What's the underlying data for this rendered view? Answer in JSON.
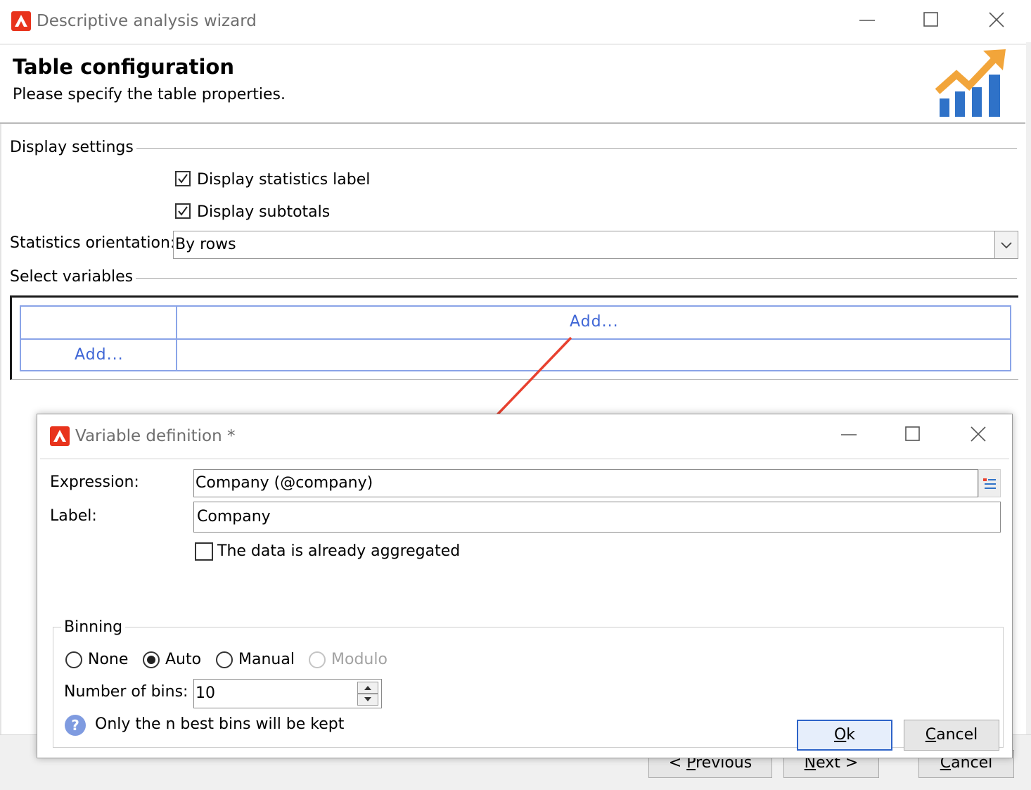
{
  "window": {
    "title": "Descriptive analysis wizard",
    "header_title": "Table configuration",
    "header_subtitle": "Please specify the table properties."
  },
  "display_settings": {
    "group_label": "Display settings",
    "statistics_label": {
      "label": "Display statistics label",
      "checked": true
    },
    "subtotals": {
      "label": "Display subtotals",
      "checked": true
    },
    "orientation_label": "Statistics orientation:",
    "orientation_value": "By rows"
  },
  "select_variables": {
    "group_label": "Select variables",
    "add_column": "Add...",
    "add_row": "Add..."
  },
  "footer": {
    "previous": {
      "pre": "< ",
      "key": "P",
      "rest": "revious"
    },
    "next": {
      "key": "N",
      "rest": "ext >"
    },
    "cancel": {
      "key": "C",
      "rest": "ancel"
    }
  },
  "dialog": {
    "title": "Variable definition *",
    "expression_label": "Expression:",
    "expression_value": "Company (@company)",
    "label_label": "Label:",
    "label_value": "Company",
    "aggregated": {
      "label": "The data is already aggregated",
      "checked": false
    },
    "binning": {
      "group_label": "Binning",
      "options": [
        "None",
        "Auto",
        "Manual",
        "Modulo"
      ],
      "selected": "Auto",
      "disabled": [
        "Modulo"
      ],
      "bins_label": "Number of bins:",
      "bins_value": "10",
      "hint": "Only the n best bins will be kept"
    },
    "ok": {
      "key": "O",
      "rest": "k"
    },
    "cancel": {
      "key": "C",
      "rest": "ancel"
    }
  },
  "colors": {
    "accent": "#3f66d6",
    "app_logo": "#e8331c",
    "annotation_arrow": "#e8412f",
    "chart_orange": "#f2a53a",
    "chart_blue": "#2f72c8"
  }
}
